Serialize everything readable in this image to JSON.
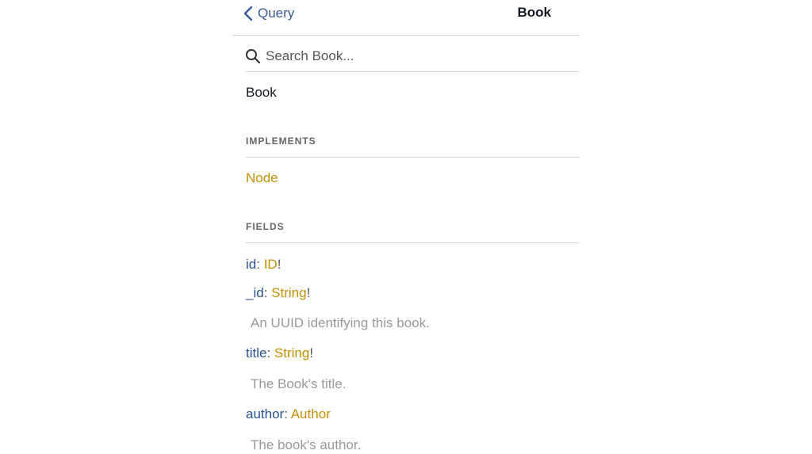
{
  "header": {
    "back_label": "Query",
    "title": "Book"
  },
  "search": {
    "placeholder": "Search Book..."
  },
  "type_name": "Book",
  "implements": {
    "title": "IMPLEMENTS",
    "items": [
      "Node"
    ]
  },
  "fields": {
    "title": "FIELDS",
    "items": [
      {
        "name": "id",
        "colon": ": ",
        "type": "ID",
        "bang": "!",
        "description": ""
      },
      {
        "name": "_id",
        "colon": ": ",
        "type": "String",
        "bang": "!",
        "description": "An UUID identifying this book."
      },
      {
        "name": "title",
        "colon": ": ",
        "type": "String",
        "bang": "!",
        "description": "The Book's title."
      },
      {
        "name": "author",
        "colon": ": ",
        "type": "Author",
        "bang": "",
        "description": "The book's author."
      }
    ]
  },
  "colors": {
    "field_name": "#2a5295",
    "type": "#c39106",
    "description": "#999999"
  }
}
